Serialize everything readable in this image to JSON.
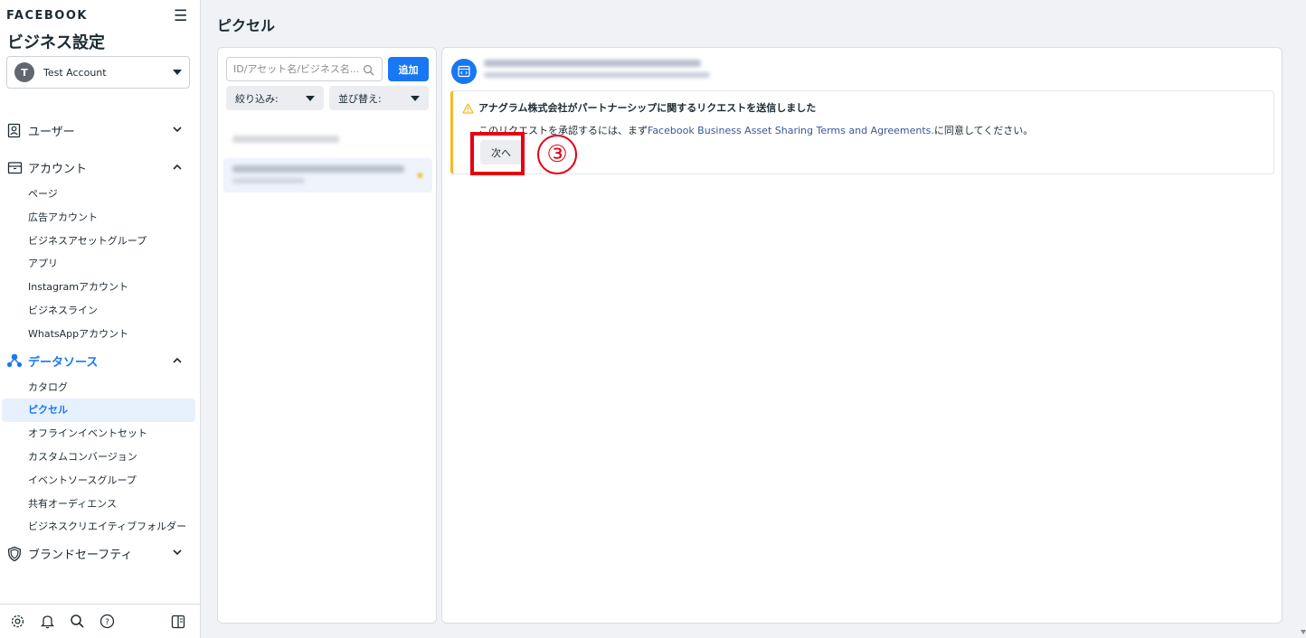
{
  "sidebar": {
    "brand": "FACEBOOK",
    "title": "ビジネス設定",
    "account": {
      "initial": "T",
      "name": "Test Account"
    },
    "sections": [
      {
        "label": "ユーザー",
        "icon": "user-icon",
        "expanded": false
      },
      {
        "label": "アカウント",
        "icon": "briefcase-icon",
        "expanded": true,
        "items": [
          "ページ",
          "広告アカウント",
          "ビジネスアセットグループ",
          "アプリ",
          "Instagramアカウント",
          "ビジネスライン",
          "WhatsAppアカウント"
        ]
      },
      {
        "label": "データソース",
        "icon": "data-sources-icon",
        "expanded": true,
        "active": true,
        "items": [
          "カタログ",
          "ピクセル",
          "オフラインイベントセット",
          "カスタムコンバージョン",
          "イベントソースグループ",
          "共有オーディエンス",
          "ビジネスクリエイティブフォルダー"
        ]
      },
      {
        "label": "ブランドセーフティ",
        "icon": "shield-icon",
        "expanded": false
      }
    ],
    "active_item": "ピクセル",
    "footer_icons": [
      "gear-icon",
      "bell-icon",
      "search-icon",
      "help-icon",
      "panel-toggle-icon"
    ]
  },
  "main": {
    "title": "ピクセル",
    "list": {
      "search_placeholder": "ID/アセット名/ビジネス名...",
      "add_label": "追加",
      "filter_label": "絞り込み:",
      "sort_label": "並び替え:"
    },
    "alert": {
      "title": "アナグラム株式会社がパートナーシップに関するリクエストを送信しました",
      "body_prefix": "このリクエストを承認するには、まず",
      "link_text": "Facebook Business Asset Sharing Terms and Agreements.",
      "body_suffix": "に同意してください。",
      "button_label": "次へ"
    },
    "annotation": {
      "marker": "③",
      "color": "#e60012"
    }
  },
  "colors": {
    "accent": "#1877f2",
    "warning": "#f7b928",
    "annotation": "#e60012"
  }
}
